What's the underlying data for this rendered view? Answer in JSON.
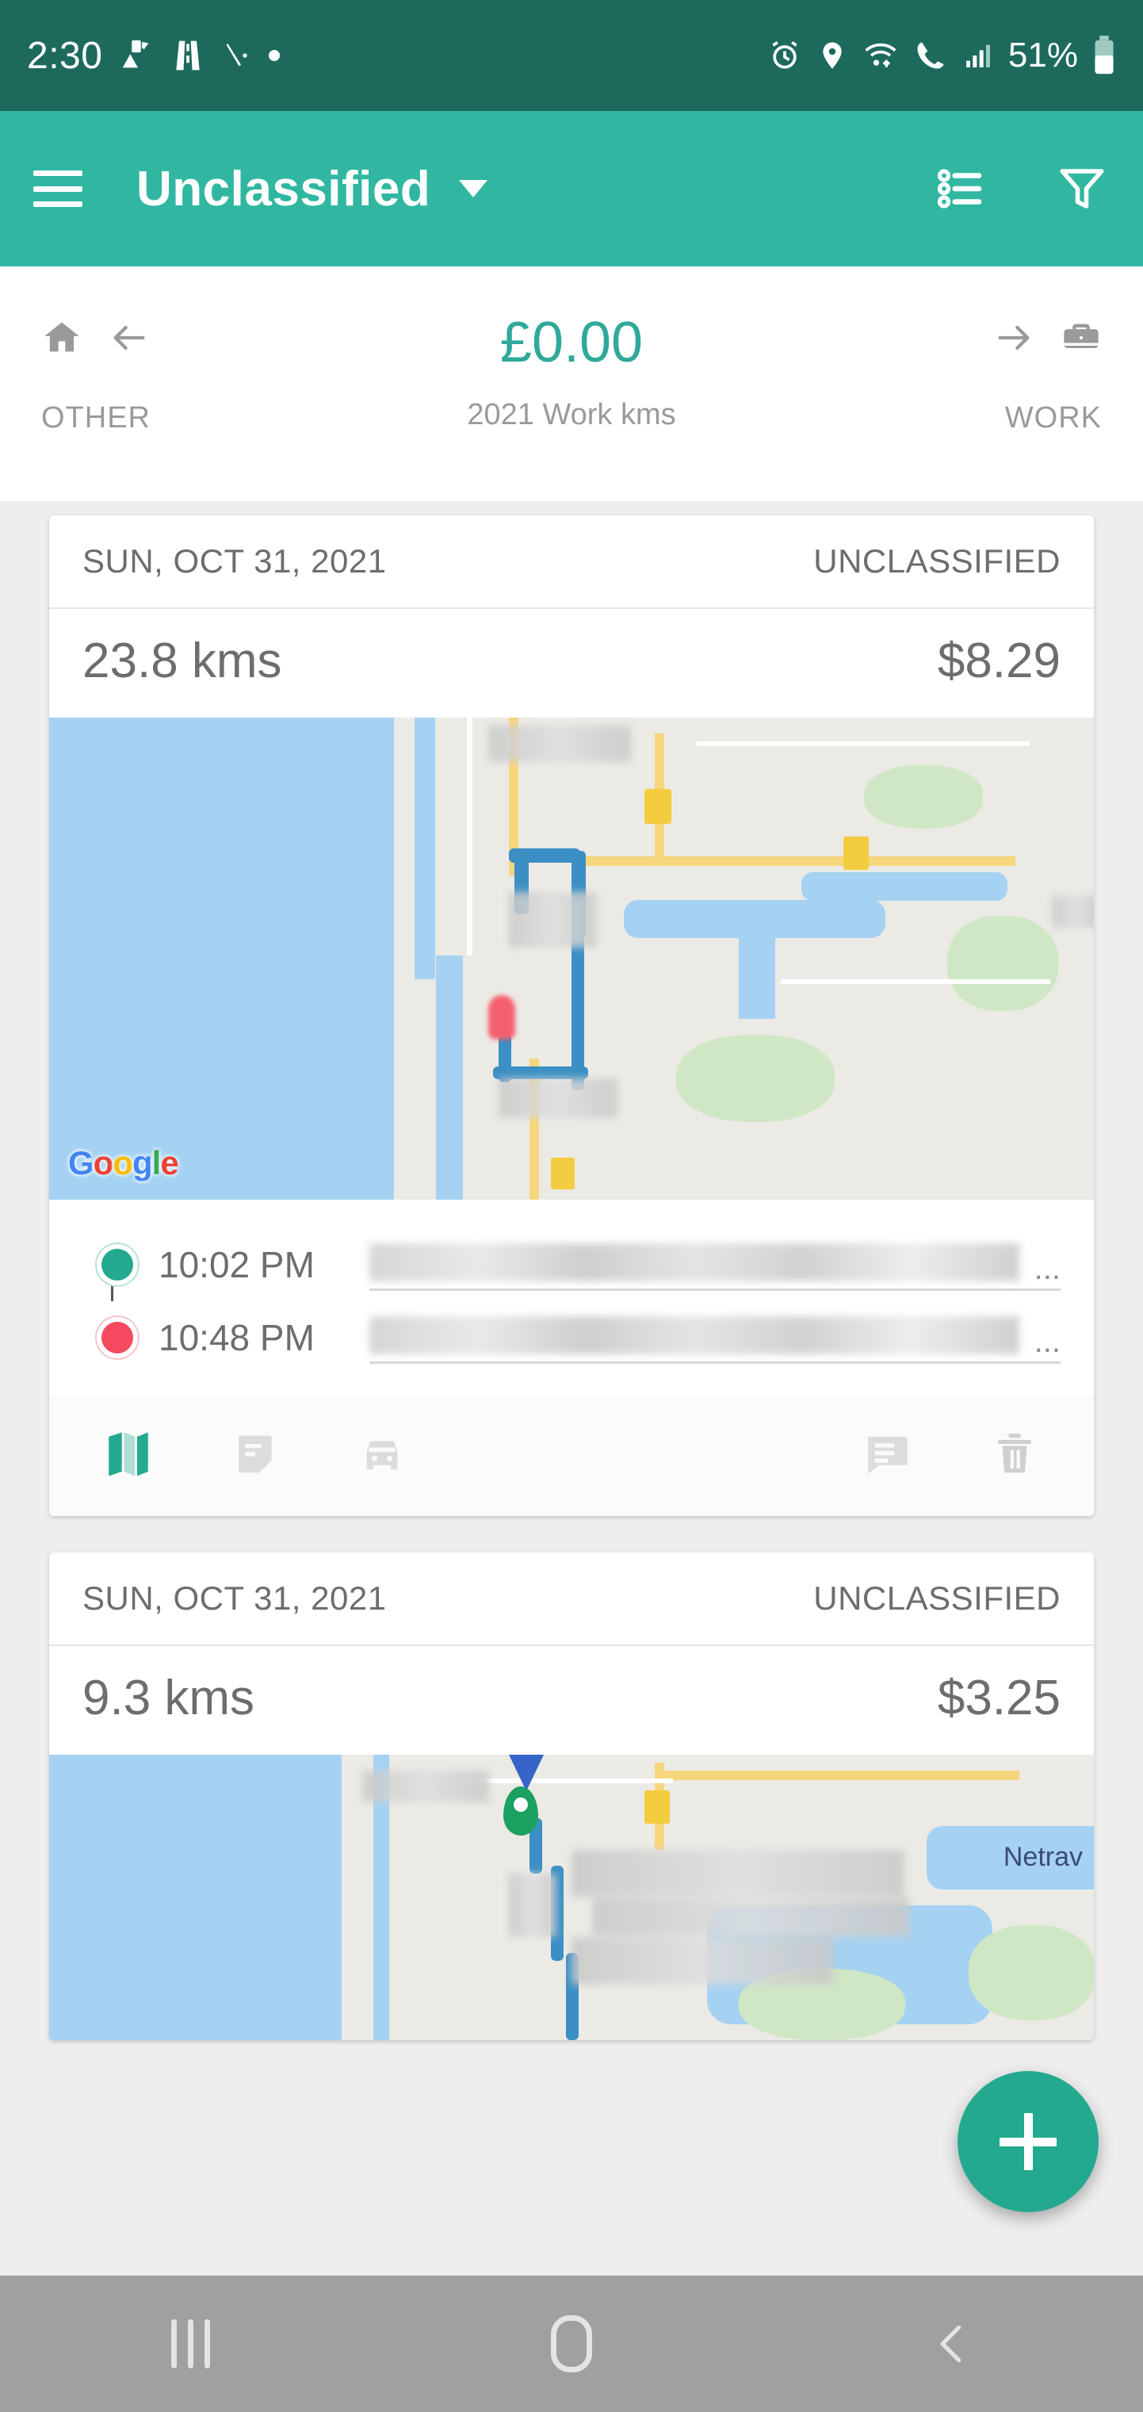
{
  "status_bar": {
    "time": "2:30",
    "battery_percent": "51%",
    "icons": [
      "fuel-wrench-icon",
      "road-icon",
      "tools-icon",
      "dot-icon",
      "alarm-icon",
      "location-icon",
      "wifi-icon",
      "call-wifi-icon",
      "signal-icon",
      "battery-icon"
    ]
  },
  "app_bar": {
    "title": "Unclassified",
    "menu_icon": "hamburger-icon",
    "dropdown_icon": "chevron-down-icon",
    "list_icon": "bulleted-list-icon",
    "filter_icon": "funnel-filter-icon",
    "background": "#31b7a1"
  },
  "summary": {
    "left_label": "OTHER",
    "left_icons": [
      "home-icon",
      "arrow-left-icon"
    ],
    "amount": "£0.00",
    "amount_color": "#2fa99a",
    "subtitle": "2021 Work kms",
    "right_label": "WORK",
    "right_icons": [
      "arrow-right-icon",
      "briefcase-icon"
    ]
  },
  "trips": [
    {
      "date": "SUN, OCT 31, 2021",
      "status": "UNCLASSIFIED",
      "distance": "23.8 kms",
      "cost": "$8.29",
      "map_attribution": "Google",
      "start_time": "10:02 PM",
      "end_time": "10:48 PM",
      "start_address": "",
      "end_address": "",
      "address_ellipsis": "...",
      "actions": [
        "map-icon",
        "note-icon",
        "car-icon",
        "comment-icon",
        "trash-icon"
      ]
    },
    {
      "date": "SUN, OCT 31, 2021",
      "status": "UNCLASSIFIED",
      "distance": "9.3 kms",
      "cost": "$3.25",
      "map_town_label": "Netrav"
    }
  ],
  "fab": {
    "icon": "plus-icon",
    "color": "#22a98f"
  },
  "nav_bar": {
    "recents_icon": "recents-icon",
    "home_icon": "home-square-icon",
    "back_icon": "back-chevron-icon"
  }
}
